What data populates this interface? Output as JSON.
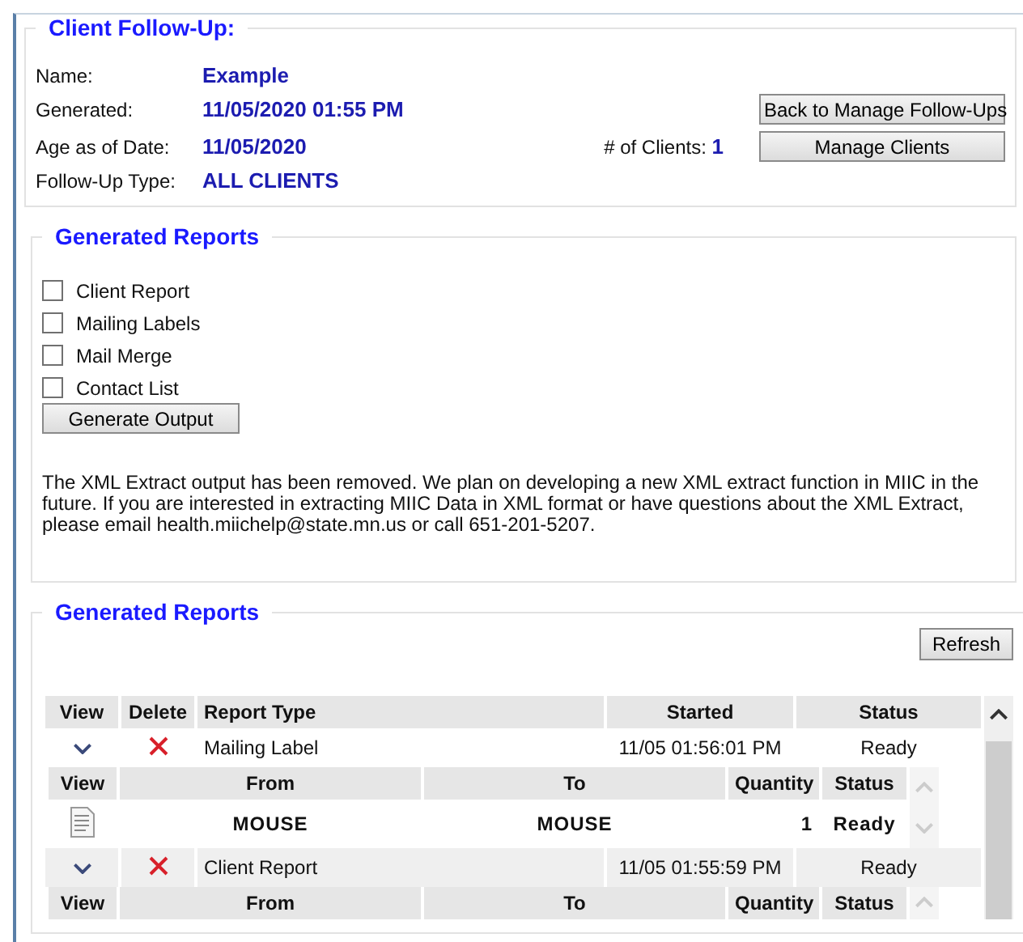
{
  "follow_up": {
    "legend": "Client Follow-Up:",
    "fields": [
      {
        "label": "Name:",
        "value": "Example"
      },
      {
        "label": "Generated:",
        "value": "11/05/2020 01:55 PM"
      },
      {
        "label": "Age as of Date:",
        "value": "11/05/2020"
      },
      {
        "label": "Follow-Up Type:",
        "value": "ALL CLIENTS"
      }
    ],
    "clients": {
      "label": "# of Clients:",
      "value": "1"
    },
    "buttons": [
      "Back to Manage Follow-Ups",
      "Manage Clients"
    ]
  },
  "output": {
    "legend": "Generated Reports",
    "checkboxes": [
      {
        "label": "Client Report",
        "checked": false
      },
      {
        "label": "Mailing Labels",
        "checked": false
      },
      {
        "label": "Mail Merge",
        "checked": false
      },
      {
        "label": "Contact List",
        "checked": false
      }
    ],
    "button": "Generate Output",
    "notice": "The XML Extract output has been removed. We plan on developing a new XML extract function in MIIC in the future. If you are interested in extracting MIIC Data in XML format or have questions about the XML Extract, please email health.miichelp@state.mn.us or call 651-201-5207."
  },
  "reports": {
    "legend": "Generated Reports",
    "refresh": "Refresh",
    "columns": [
      "View",
      "Delete",
      "Report Type",
      "Started",
      "Status"
    ],
    "rows": [
      {
        "type": "Mailing Label",
        "started": "11/05 01:56:01 PM",
        "status": "Ready",
        "detail": {
          "columns": [
            "View",
            "From",
            "To",
            "Quantity",
            "Status"
          ],
          "rows": [
            {
              "from": "MOUSE",
              "to": "MOUSE",
              "quantity": "1",
              "status": "Ready"
            }
          ]
        }
      },
      {
        "type": "Client Report",
        "started": "11/05 01:55:59 PM",
        "status": "Ready",
        "detail": {
          "columns": [
            "View",
            "From",
            "To",
            "Quantity",
            "Status"
          ]
        }
      }
    ]
  }
}
